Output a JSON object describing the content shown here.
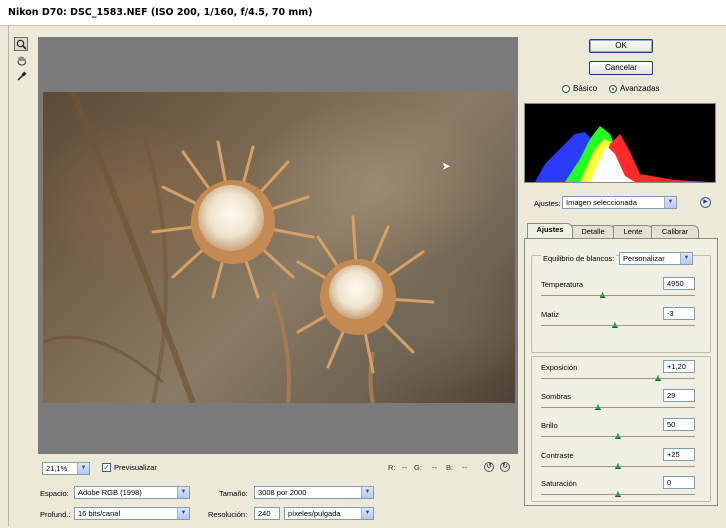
{
  "window": {
    "title": "Nikon D70:  DSC_1583.NEF  (ISO 200, 1/160, f/4.5, 70 mm)"
  },
  "tools": [
    {
      "name": "zoom-tool",
      "icon": "magnifier-icon"
    },
    {
      "name": "hand-tool",
      "icon": "hand-icon"
    },
    {
      "name": "eyedropper-tool",
      "icon": "eyedropper-icon"
    }
  ],
  "buttons": {
    "ok": "OK",
    "cancel": "Cancelar"
  },
  "mode": {
    "basic": "Básico",
    "advanced": "Avanzadas",
    "selected": "advanced"
  },
  "settings": {
    "label": "Ajustes:",
    "value": "Imagen seleccionada"
  },
  "tabs": [
    {
      "label": "Ajustes",
      "active": true
    },
    {
      "label": "Detalle",
      "active": false
    },
    {
      "label": "Lente",
      "active": false
    },
    {
      "label": "Calibrar",
      "active": false
    }
  ],
  "white_balance": {
    "label": "Equilibrio de blancos:",
    "value": "Personalizar"
  },
  "sliders": [
    {
      "label": "Temperatura",
      "value": "4950",
      "pos": 0.4
    },
    {
      "label": "Matiz",
      "value": "-3",
      "pos": 0.48
    },
    {
      "label": "Exposición",
      "value": "+1,20",
      "pos": 0.76
    },
    {
      "label": "Sombras",
      "value": "29",
      "pos": 0.37
    },
    {
      "label": "Brillo",
      "value": "50",
      "pos": 0.5
    },
    {
      "label": "Contraste",
      "value": "+25",
      "pos": 0.5
    },
    {
      "label": "Saturación",
      "value": "0",
      "pos": 0.5
    }
  ],
  "zoom": {
    "value": "21,1%"
  },
  "preview_label": "Previsualizar",
  "preview_checked": true,
  "rgb": {
    "r": "R:",
    "g": "G:",
    "b": "B:",
    "r_val": "--",
    "g_val": "--",
    "b_val": "--"
  },
  "workflow": {
    "space_label": "Espacio:",
    "space_value": "Adobe RGB (1998)",
    "depth_label": "Profund.:",
    "depth_value": "16 bits/canal",
    "size_label": "Tamaño:",
    "size_value": "3008 por 2000",
    "res_label": "Resolución:",
    "res_value": "240",
    "res_unit": "píxeles/pulgada"
  },
  "colors": {
    "histogram_red": "#ff2a2a",
    "histogram_green": "#22ff22",
    "histogram_blue": "#2a3cff",
    "histogram_yellow": "#ffff33",
    "histogram_white": "#ffffff"
  }
}
